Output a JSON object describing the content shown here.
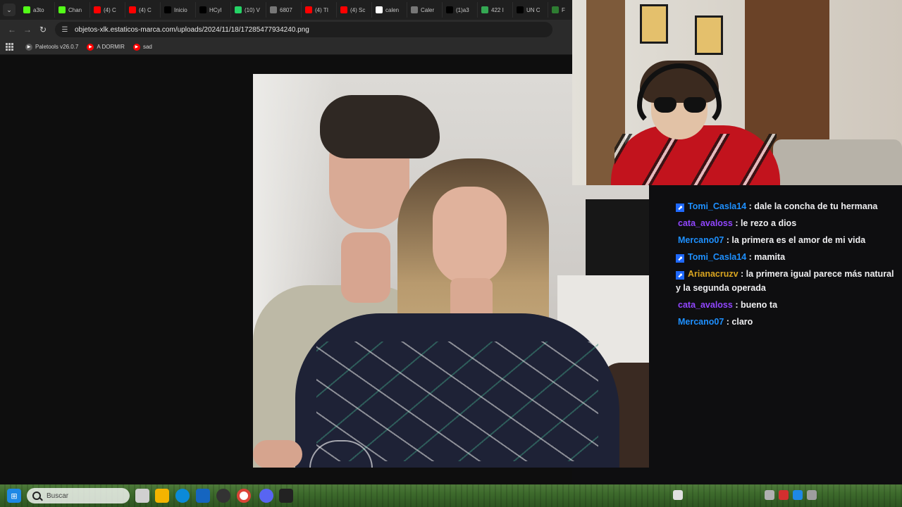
{
  "browser": {
    "tabs": [
      {
        "label": "a3to",
        "icon": "kick-icon",
        "color": "#53fc18"
      },
      {
        "label": "Chan",
        "icon": "kick-icon",
        "color": "#53fc18"
      },
      {
        "label": "(4) C",
        "icon": "youtube-icon",
        "color": "#ff0000"
      },
      {
        "label": "(4) C",
        "icon": "youtube-icon",
        "color": "#ff0000"
      },
      {
        "label": "Inicio",
        "icon": "x-icon",
        "color": "#000000"
      },
      {
        "label": "HCyI",
        "icon": "x-icon",
        "color": "#000000"
      },
      {
        "label": "(10) V",
        "icon": "whatsapp-icon",
        "color": "#25d366"
      },
      {
        "label": "6807",
        "icon": "globe-icon",
        "color": "#777777"
      },
      {
        "label": "(4) TI",
        "icon": "youtube-icon",
        "color": "#ff0000"
      },
      {
        "label": "(4) Sc",
        "icon": "youtube-icon",
        "color": "#ff0000"
      },
      {
        "label": "calen",
        "icon": "google-icon",
        "color": "#ffffff"
      },
      {
        "label": "Caler",
        "icon": "globe-icon",
        "color": "#777777"
      },
      {
        "label": "(1)a3",
        "icon": "tiktok-icon",
        "color": "#000000"
      },
      {
        "label": "422 I",
        "icon": "maps-icon",
        "color": "#34a853"
      },
      {
        "label": "UN C",
        "icon": "tiktok-icon",
        "color": "#000000"
      },
      {
        "label": "F",
        "icon": "generic-icon",
        "color": "#2e7d32"
      }
    ],
    "url": "objetos-xlk.estaticos-marca.com/uploads/2024/11/18/17285477934240.png",
    "bookmarks": [
      {
        "label": "Paletools v26.0.7",
        "icon": "globe-icon",
        "color": "#5a5a5a"
      },
      {
        "label": "A DORMIR",
        "icon": "youtube-icon",
        "color": "#ff0000"
      },
      {
        "label": "sad",
        "icon": "youtube-icon",
        "color": "#ff0000"
      }
    ]
  },
  "chat": {
    "messages": [
      {
        "badge": true,
        "user": "Tomi_Casla14",
        "color": "#1e90ff",
        "text": "dale la concha de tu hermana"
      },
      {
        "badge": false,
        "user": "cata_avaloss",
        "color": "#9146ff",
        "text": "le rezo a dios"
      },
      {
        "badge": false,
        "user": "Mercano07",
        "color": "#1e90ff",
        "text": "la primera es el amor de mi vida"
      },
      {
        "badge": true,
        "user": "Tomi_Casla14",
        "color": "#1e90ff",
        "text": "mamita"
      },
      {
        "badge": true,
        "user": "Arianacruzv",
        "color": "#daa520",
        "text": "la primera igual parece más natural y la segunda operada"
      },
      {
        "badge": false,
        "user": "cata_avaloss",
        "color": "#9146ff",
        "text": "bueno ta"
      },
      {
        "badge": false,
        "user": "Mercano07",
        "color": "#1e90ff",
        "text": "claro"
      }
    ]
  },
  "taskbar": {
    "search_placeholder": "Buscar"
  }
}
